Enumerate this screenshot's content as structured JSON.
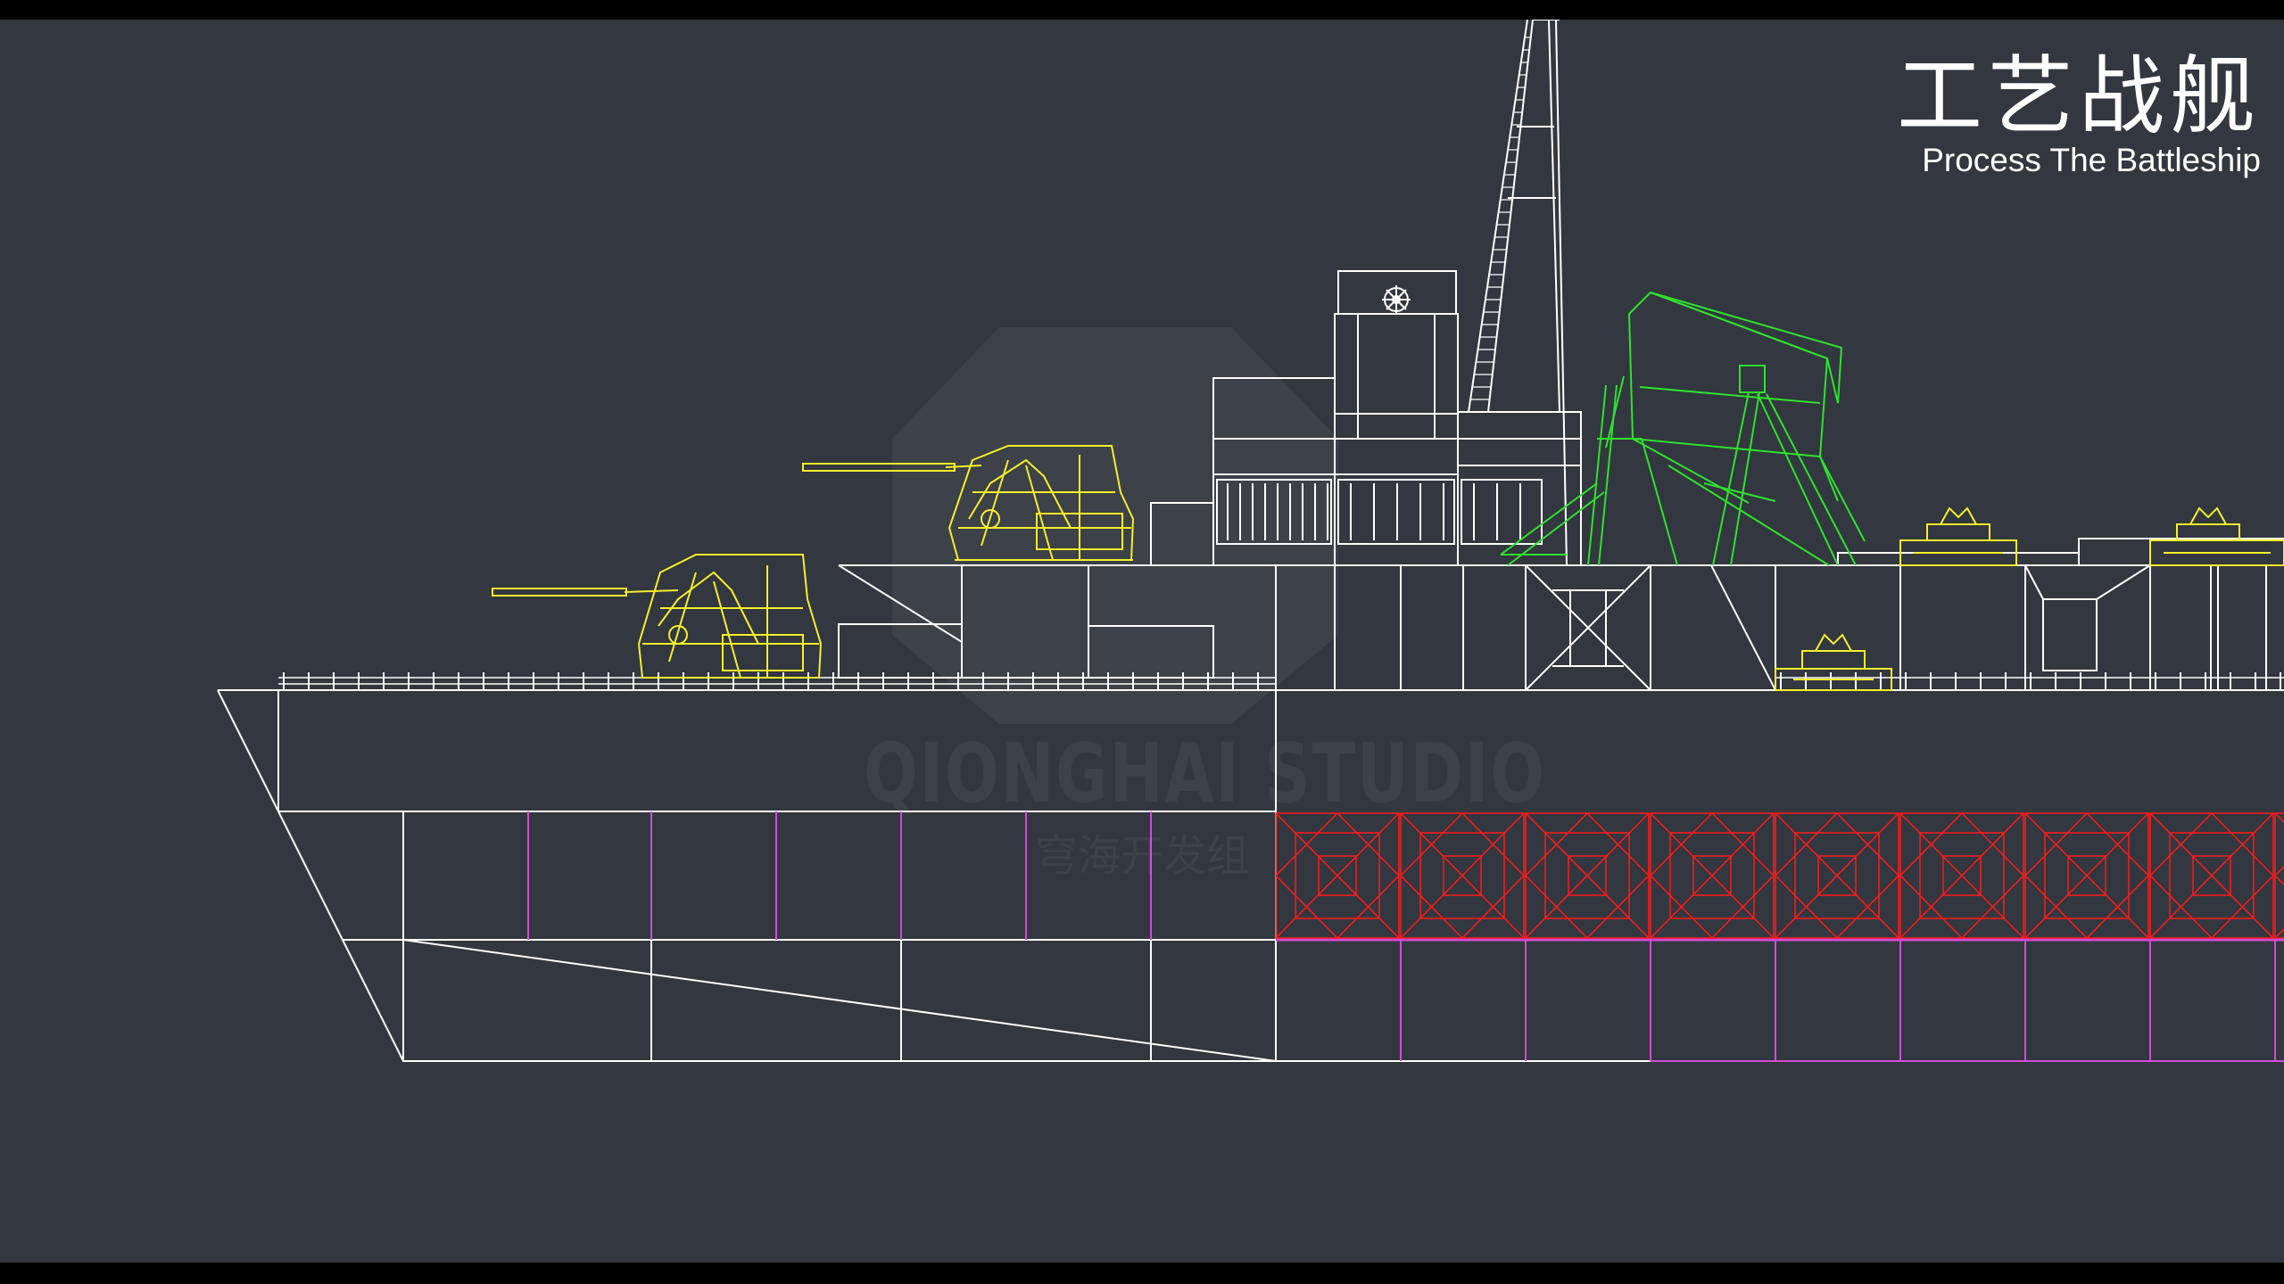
{
  "title": {
    "chinese": "工艺战舰",
    "english": "Process The Battleship"
  },
  "watermark": {
    "studio_en": "QIONGHAI STUDIO",
    "studio_cn": "穹海开发组"
  },
  "colors": {
    "background": "#33373f",
    "hull_lines": "#ffffff",
    "turrets": "#f5f02a",
    "crane": "#2ee32e",
    "compartments": "#ff1a1a",
    "frames": "#d14bd6"
  },
  "icons": [
    "ship-wheel-icon"
  ]
}
